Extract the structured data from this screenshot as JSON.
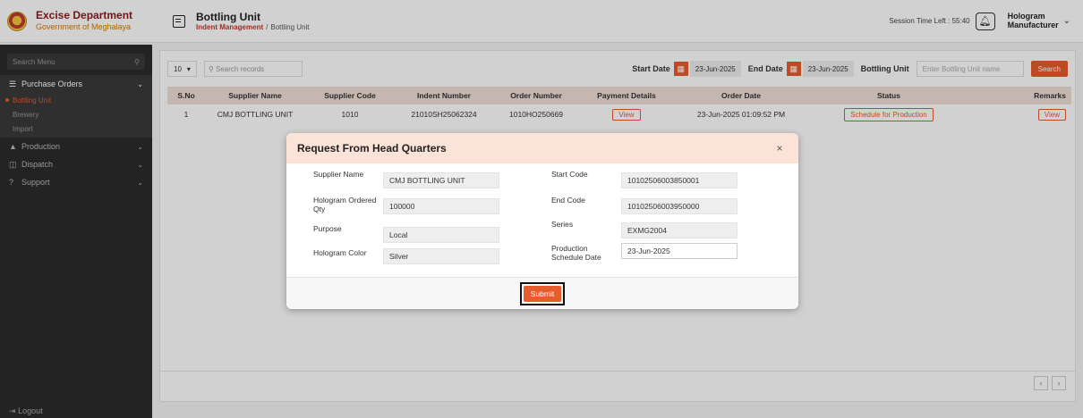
{
  "header": {
    "brand_title": "Excise Department",
    "brand_subtitle": "Government of Meghalaya",
    "page_title": "Bottling Unit",
    "breadcrumb_active": "Indent Management",
    "breadcrumb_sep": "/",
    "breadcrumb_current": "Bottling Unit",
    "session_text": "Session Time Left : 55:40",
    "user_line1": "Hologram",
    "user_line2": "Manufacturer"
  },
  "sidebar": {
    "search_placeholder": "Search Menu",
    "groups": [
      {
        "label": "Purchase Orders",
        "icon": "list-icon"
      },
      {
        "label": "Production",
        "icon": "triangle-icon"
      },
      {
        "label": "Dispatch",
        "icon": "truck-icon"
      },
      {
        "label": "Support",
        "icon": "help-icon"
      }
    ],
    "sub_items": [
      "Bottling Unit",
      "Brewery",
      "Import"
    ],
    "logout": "Logout"
  },
  "toolbar": {
    "per_page": "10",
    "search_placeholder": "Search records",
    "start_label": "Start Date",
    "start_value": "23-Jun-2025",
    "end_label": "End Date",
    "end_value": "23-Jun-2025",
    "bu_label": "Bottling Unit",
    "bu_placeholder": "Enter Bottling Unit name",
    "search_button": "Search"
  },
  "table": {
    "headers": [
      "S.No",
      "Supplier Name",
      "Supplier Code",
      "Indent Number",
      "Order Number",
      "Payment Details",
      "Order Date",
      "Status",
      "Remarks"
    ],
    "rows": [
      {
        "sno": "1",
        "supplier": "CMJ BOTTLING UNIT",
        "code": "1010",
        "indent": "21010SH25062324",
        "order": "1010HO250669",
        "payment": "View",
        "date": "23-Jun-2025 01:09:52 PM",
        "status": "Schedule for Production",
        "remarks": "View"
      }
    ]
  },
  "modal": {
    "title": "Request From Head Quarters",
    "fields": {
      "supplier_name_label": "Supplier Name",
      "supplier_name": "CMJ BOTTLING UNIT",
      "ordered_qty_label": "Hologram Ordered Qty",
      "ordered_qty": "100000",
      "purpose_label": "Purpose",
      "purpose": "Local",
      "color_label": "Hologram Color",
      "color": "Silver",
      "start_code_label": "Start Code",
      "start_code": "10102506003850001",
      "end_code_label": "End Code",
      "end_code": "10102506003950000",
      "series_label": "Series",
      "series": "EXMG2004",
      "schedule_label": "Production Schedule Date",
      "schedule": "23-Jun-2025"
    },
    "submit": "Submit"
  },
  "colors": {
    "accent": "#e65c2c",
    "sidebar": "#2b2b2b",
    "header_tint": "#f0e0d6"
  }
}
